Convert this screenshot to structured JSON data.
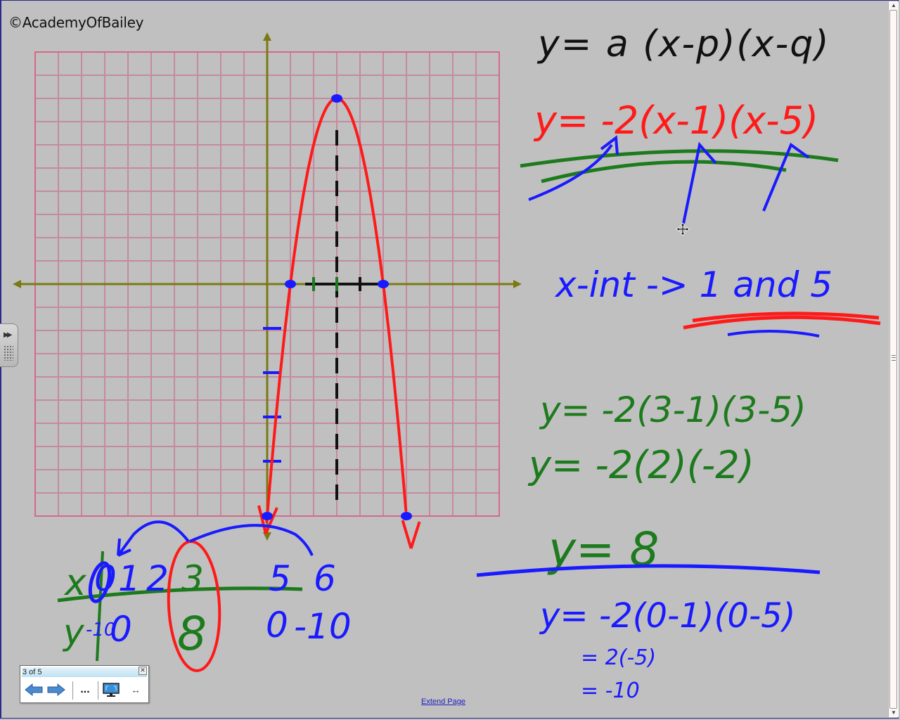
{
  "watermark": "©AcademyOfBailey",
  "whiteboard": {
    "general_form": "y= a (x-p)(x-q)",
    "specific_form": "y= -2(x-1)(x-5)",
    "x_intercepts_note": "x-int -> 1 and 5",
    "vertex_calc": [
      "y= -2(3-1)(3-5)",
      "y= -2(2)(-2)",
      "y= 8"
    ],
    "y_intercept_calc": [
      "y= -2(0-1)(0-5)",
      "= 2(-5)",
      "= -10"
    ],
    "table": {
      "x_label": "x",
      "y_label": "y",
      "x_values": [
        "0",
        "1",
        "2",
        "3",
        "5",
        "6"
      ],
      "y_values": [
        "-10",
        "0",
        "8",
        "0",
        "-10"
      ]
    },
    "colors": {
      "black": "#111111",
      "red": "#ff1a1a",
      "blue": "#1a1aff",
      "green": "#1d7a1d",
      "axis": "#7a7a14",
      "grid": "#c58aa0"
    }
  },
  "chart_data": {
    "type": "line",
    "title": "y = -2(x-1)(x-5)",
    "function": "y = -2(x-1)(x-5)",
    "x_range": [
      -10,
      10
    ],
    "y_range": [
      -10,
      10
    ],
    "x_unit_per_cell": 1,
    "y_unit_per_cell": 1,
    "grid": true,
    "vertex": [
      3,
      8
    ],
    "axis_of_symmetry": 3,
    "x_intercepts": [
      [
        1,
        0
      ],
      [
        5,
        0
      ]
    ],
    "y_intercept": [
      0,
      -10
    ],
    "marked_points": [
      [
        0,
        -10
      ],
      [
        1,
        0
      ],
      [
        3,
        8
      ],
      [
        5,
        0
      ],
      [
        6,
        -10
      ]
    ],
    "x_tick_marks": [
      2,
      3,
      4
    ],
    "y_tick_marks": [
      -2,
      -4,
      -6,
      -8
    ]
  },
  "page_nav": {
    "title": "3 of 5",
    "close": "x",
    "prev_icon": "arrow-left-icon",
    "next_icon": "arrow-right-icon",
    "more_label": "...",
    "display_icon": "monitor-icon",
    "resize_icon": "resize-horizontal-icon"
  },
  "extend_page_label": "Extend Page",
  "side_tab_icon": "double-chevron-right-icon"
}
